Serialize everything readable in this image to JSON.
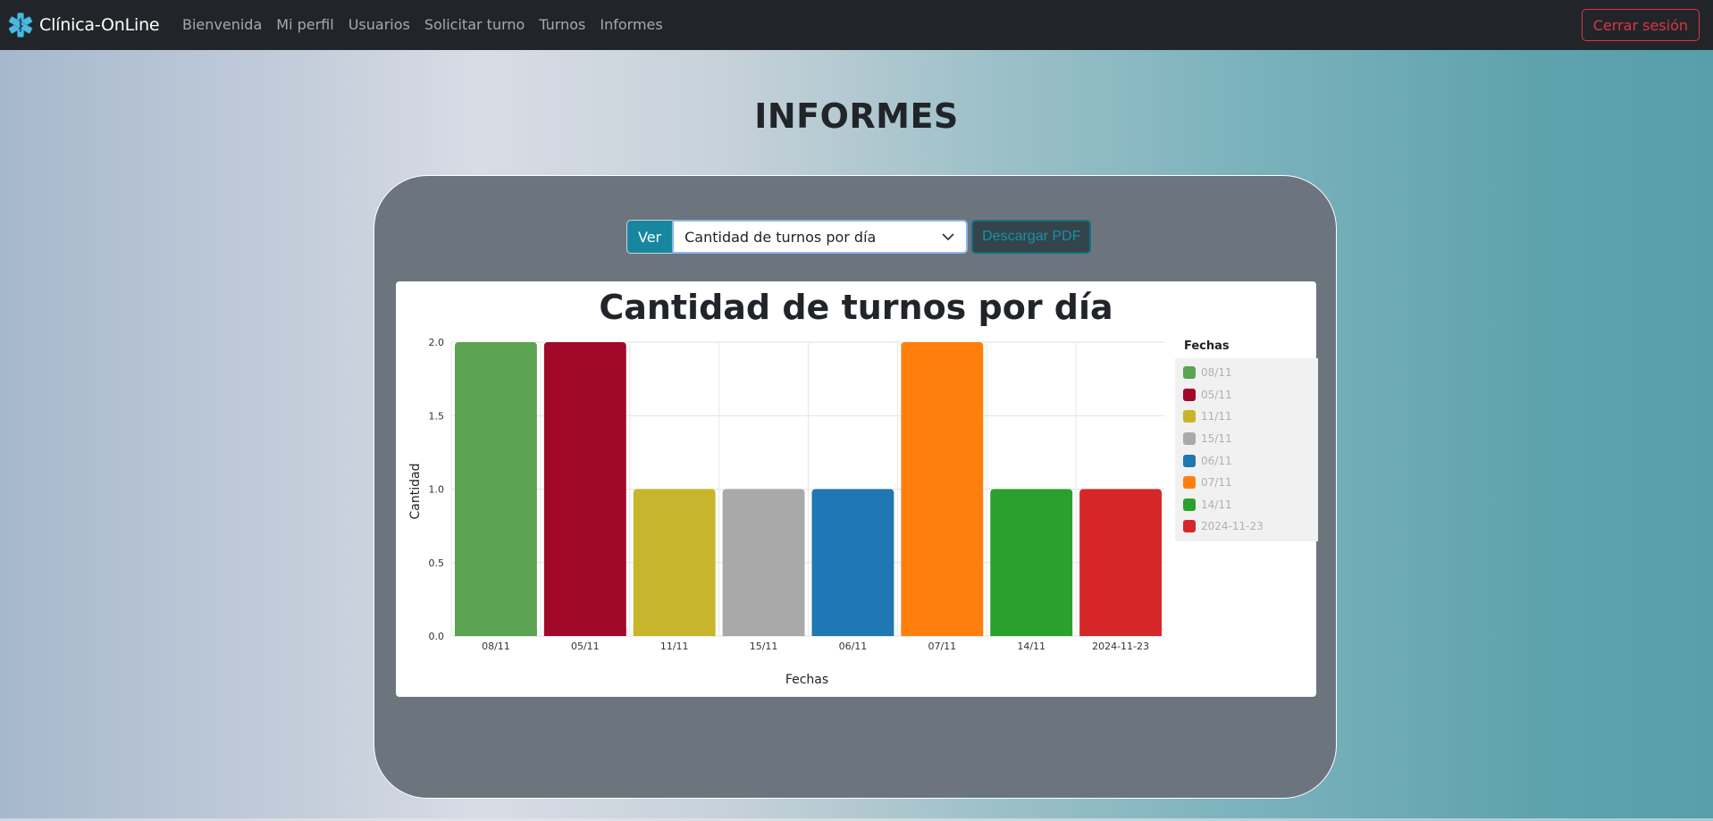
{
  "app": {
    "brand": "Clínica-OnLine",
    "nav": [
      "Bienvenida",
      "Mi perfil",
      "Usuarios",
      "Solicitar turno",
      "Turnos",
      "Informes"
    ],
    "logout_label": "Cerrar sesión"
  },
  "page": {
    "title": "INFORMES"
  },
  "controls": {
    "ver_label": "Ver",
    "selected_report": "Cantidad de turnos por día",
    "download_label": "Descargar PDF"
  },
  "icons": {
    "brand": "medical-star-of-life-icon",
    "select": "chevron-down-icon"
  },
  "colors": {
    "navbar": "#212529",
    "panel": "#6c757d",
    "logout": "#dc3545",
    "ver": "#17879f"
  },
  "chart_data": {
    "type": "bar",
    "title": "Cantidad de turnos por día",
    "xlabel": "Fechas",
    "ylabel": "Cantidad",
    "ylim": [
      0,
      2
    ],
    "yticks": [
      "0.0",
      "0.5",
      "1.0",
      "1.5",
      "2.0"
    ],
    "categories": [
      "08/11",
      "05/11",
      "11/11",
      "15/11",
      "06/11",
      "07/11",
      "14/11",
      "2024-11-23"
    ],
    "values": [
      2,
      2,
      1,
      1,
      1,
      2,
      1,
      1
    ],
    "colors": [
      "#5ba352",
      "#a0092a",
      "#c7b52c",
      "#a9a9a9",
      "#1f77b4",
      "#ff7f0e",
      "#2ca02c",
      "#d62728"
    ],
    "legend_title": "Fechas",
    "legend_position": "right",
    "grid": true
  }
}
